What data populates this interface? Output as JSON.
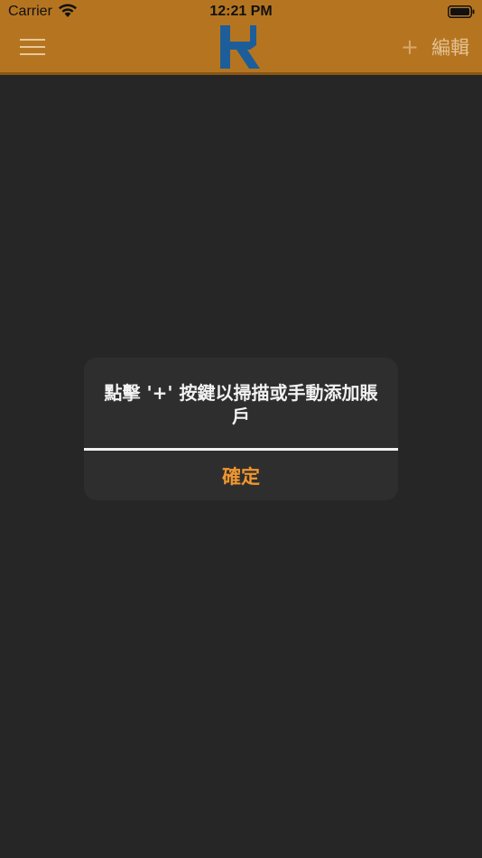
{
  "status_bar": {
    "carrier": "Carrier",
    "time": "12:21 PM"
  },
  "nav": {
    "menu_icon": "hamburger-menu-icon",
    "logo": "hk-logo",
    "add_label": "+",
    "edit_label": "編輯"
  },
  "alert": {
    "message": "點擊 '+' 按鍵以掃描或手動添加賬戶",
    "confirm_label": "確定"
  },
  "colors": {
    "header": "#b57520",
    "background": "#262626",
    "accent": "#f0962e",
    "logo_blue": "#1d5e9a"
  }
}
